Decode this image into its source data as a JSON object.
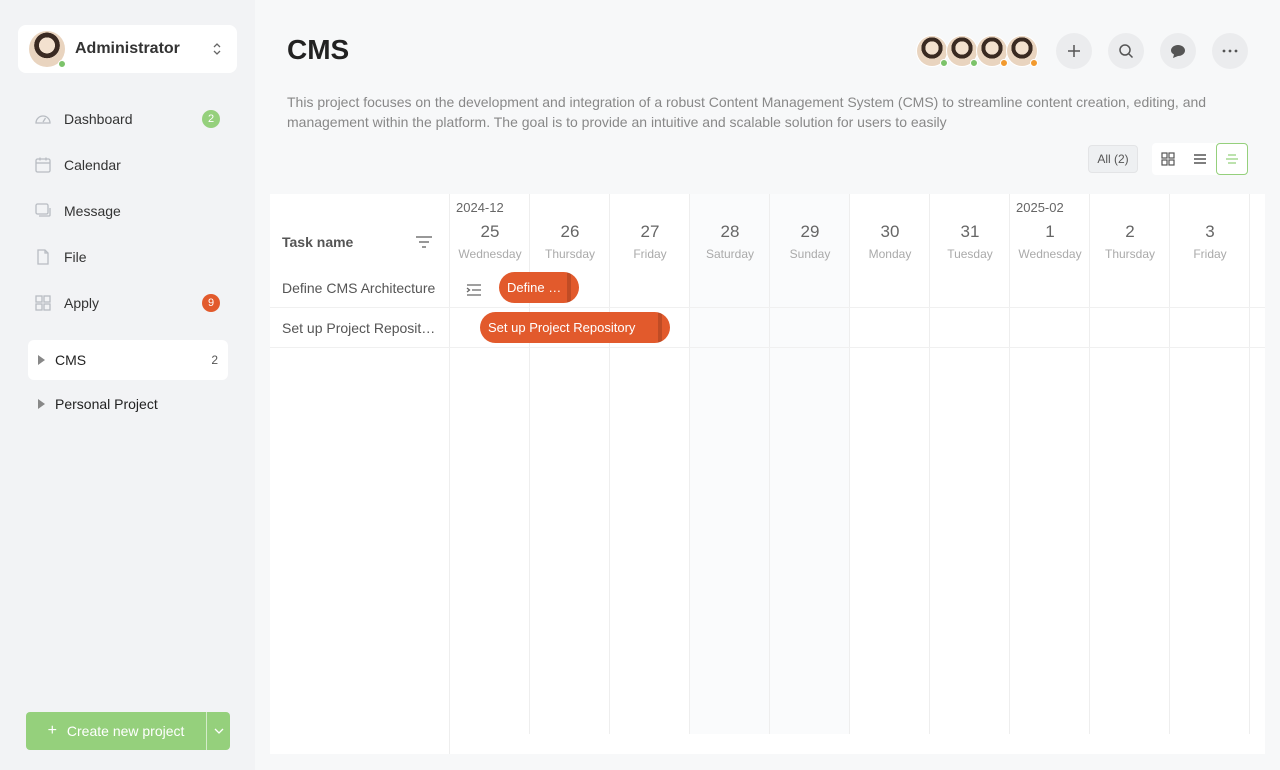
{
  "user": {
    "name": "Administrator"
  },
  "nav": [
    {
      "label": "Dashboard",
      "badge": "2",
      "badge_color": "#95d07c"
    },
    {
      "label": "Calendar",
      "badge": null
    },
    {
      "label": "Message",
      "badge": null
    },
    {
      "label": "File",
      "badge": null
    },
    {
      "label": "Apply",
      "badge": "9",
      "badge_color": "#e25a2c"
    }
  ],
  "projects": [
    {
      "label": "CMS",
      "count": "2"
    },
    {
      "label": "Personal Project",
      "count": ""
    }
  ],
  "create_button": {
    "label": "Create new project"
  },
  "project": {
    "title": "CMS",
    "description": "This project focuses on the development and integration of a robust Content Management System (CMS) to streamline content creation, editing, and management within the platform. The goal is to provide an intuitive and scalable solution for users to easily"
  },
  "filter": {
    "all_label": "All (2)"
  },
  "gantt": {
    "task_header": "Task name",
    "months": [
      "2024-12",
      "2025-02"
    ],
    "days": [
      {
        "num": "25",
        "name": "Wednesday"
      },
      {
        "num": "26",
        "name": "Thursday"
      },
      {
        "num": "27",
        "name": "Friday"
      },
      {
        "num": "28",
        "name": "Saturday"
      },
      {
        "num": "29",
        "name": "Sunday"
      },
      {
        "num": "30",
        "name": "Monday"
      },
      {
        "num": "31",
        "name": "Tuesday"
      },
      {
        "num": "1",
        "name": "Wednesday"
      },
      {
        "num": "2",
        "name": "Thursday"
      },
      {
        "num": "3",
        "name": "Friday"
      }
    ],
    "tasks": [
      {
        "name": "Define CMS Architecture",
        "bar_label": "Define …"
      },
      {
        "name": "Set up Project Reposit…",
        "bar_label": "Set up Project Repository"
      }
    ]
  },
  "colors": {
    "accent": "#95d07c",
    "bar": "#e25a2c",
    "online": "#7cc36a",
    "away": "#f29a2e"
  }
}
